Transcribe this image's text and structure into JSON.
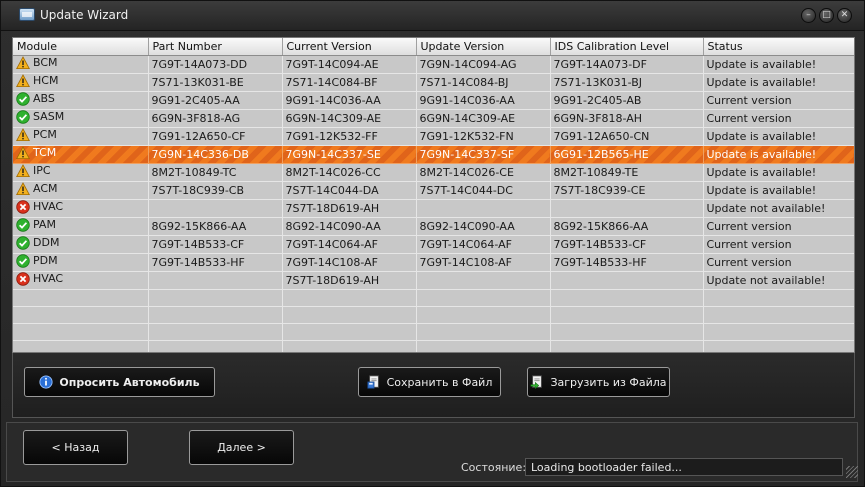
{
  "window": {
    "title": "Update Wizard",
    "minimize": "–",
    "maximize": "□",
    "close": "✕"
  },
  "columns": [
    "Module",
    "Part Number",
    "Current Version",
    "Update Version",
    "IDS Calibration Level",
    "Status"
  ],
  "rows": [
    {
      "icon": "warning",
      "module": "BCM",
      "part": "7G9T-14A073-DD",
      "current": "7G9T-14C094-AE",
      "update": "7G9N-14C094-AG",
      "ids": "7G9T-14A073-DF",
      "status": "Update is available!"
    },
    {
      "icon": "warning",
      "module": "HCM",
      "part": "7S71-13K031-BE",
      "current": "7S71-14C084-BF",
      "update": "7S71-14C084-BJ",
      "ids": "7S71-13K031-BJ",
      "status": "Update is available!"
    },
    {
      "icon": "ok",
      "module": "ABS",
      "part": "9G91-2C405-AA",
      "current": "9G91-14C036-AA",
      "update": "9G91-14C036-AA",
      "ids": "9G91-2C405-AB",
      "status": "Current version"
    },
    {
      "icon": "ok",
      "module": "SASM",
      "part": "6G9N-3F818-AG",
      "current": "6G9N-14C309-AE",
      "update": "6G9N-14C309-AE",
      "ids": "6G9N-3F818-AH",
      "status": "Current version"
    },
    {
      "icon": "warning",
      "module": "PCM",
      "part": "7G91-12A650-CF",
      "current": "7G91-12K532-FF",
      "update": "7G91-12K532-FN",
      "ids": "7G91-12A650-CN",
      "status": "Update is available!"
    },
    {
      "icon": "warning",
      "module": "TCM",
      "part": "7G9N-14C336-DB",
      "current": "7G9N-14C337-SE",
      "update": "7G9N-14C337-SF",
      "ids": "6G91-12B565-HE",
      "status": "Update is available!",
      "selected": true
    },
    {
      "icon": "warning",
      "module": "IPC",
      "part": "8M2T-10849-TC",
      "current": "8M2T-14C026-CC",
      "update": "8M2T-14C026-CE",
      "ids": "8M2T-10849-TE",
      "status": "Update is available!"
    },
    {
      "icon": "warning",
      "module": "ACM",
      "part": "7S7T-18C939-CB",
      "current": "7S7T-14C044-DA",
      "update": "7S7T-14C044-DC",
      "ids": "7S7T-18C939-CE",
      "status": "Update is available!"
    },
    {
      "icon": "error",
      "module": "HVAC",
      "part": "",
      "current": "7S7T-18D619-AH",
      "update": "",
      "ids": "",
      "status": "Update not available!"
    },
    {
      "icon": "ok",
      "module": "PAM",
      "part": "8G92-15K866-AA",
      "current": "8G92-14C090-AA",
      "update": "8G92-14C090-AA",
      "ids": "8G92-15K866-AA",
      "status": "Current version"
    },
    {
      "icon": "ok",
      "module": "DDM",
      "part": "7G9T-14B533-CF",
      "current": "7G9T-14C064-AF",
      "update": "7G9T-14C064-AF",
      "ids": "7G9T-14B533-CF",
      "status": "Current version"
    },
    {
      "icon": "ok",
      "module": "PDM",
      "part": "7G9T-14B533-HF",
      "current": "7G9T-14C108-AF",
      "update": "7G9T-14C108-AF",
      "ids": "7G9T-14B533-HF",
      "status": "Current version"
    },
    {
      "icon": "error",
      "module": "HVAC",
      "part": "",
      "current": "7S7T-18D619-AH",
      "update": "",
      "ids": "",
      "status": "Update not available!"
    }
  ],
  "buttons": {
    "query": "Опросить Автомобиль",
    "save": "Сохранить в Файл",
    "load": "Загрузить из Файла",
    "back": "< Назад",
    "next": "Далее >"
  },
  "status": {
    "label": "Состояние:",
    "value": "Loading bootloader failed..."
  },
  "colors": {
    "selected_row": "#e96f1c",
    "warning": "#f2b01e",
    "ok": "#2fb12f",
    "error": "#d9301c"
  }
}
